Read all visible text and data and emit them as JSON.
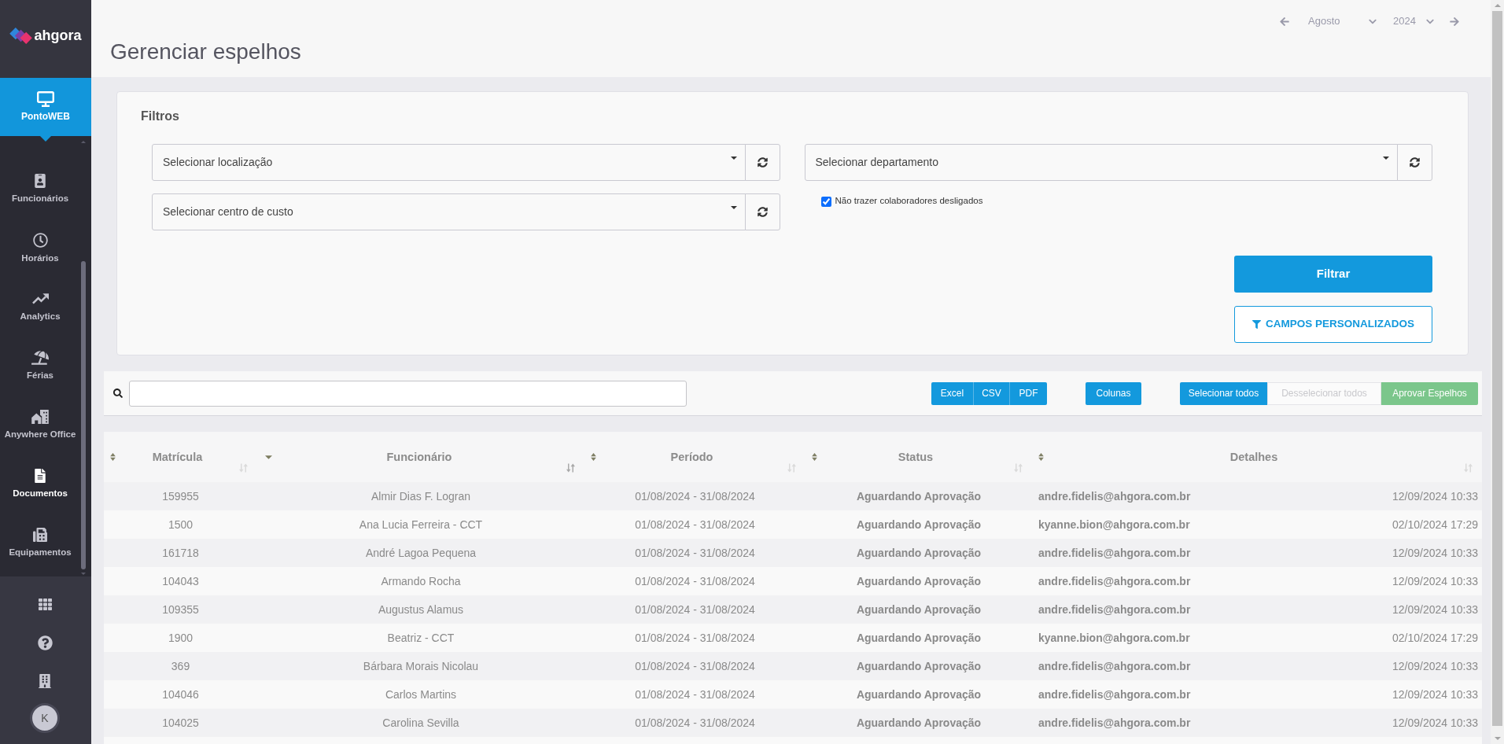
{
  "sidebar": {
    "logo": "ahgora",
    "module": {
      "label": "PontoWEB",
      "active": true
    },
    "items": [
      {
        "label": "Funcionários",
        "selected": false
      },
      {
        "label": "Horários",
        "selected": false
      },
      {
        "label": "Analytics",
        "selected": false
      },
      {
        "label": "Férias",
        "selected": false
      },
      {
        "label": "Anywhere Office",
        "selected": false
      },
      {
        "label": "Documentos",
        "selected": true
      },
      {
        "label": "Equipamentos",
        "selected": false
      }
    ],
    "user": {
      "initial": "K"
    }
  },
  "header": {
    "title": "Gerenciar espelhos",
    "month": "Agosto",
    "year": "2024"
  },
  "filters": {
    "title": "Filtros",
    "selects": [
      {
        "placeholder": "Selecionar localização"
      },
      {
        "placeholder": "Selecionar centro de custo"
      },
      {
        "placeholder": "Selecionar departamento"
      }
    ],
    "checkbox": {
      "label": "Não trazer colaboradores desligados",
      "checked": true
    },
    "submit_button": "Filtrar",
    "custom_fields_button": "CAMPOS PERSONALIZADOS"
  },
  "toolbar": {
    "export_buttons": [
      "Excel",
      "CSV",
      "PDF"
    ],
    "columns_button": "Colunas",
    "selection_buttons": [
      {
        "label": "Selecionar todos",
        "disabled": false
      },
      {
        "label": "Desselecionar todos",
        "disabled": true
      }
    ],
    "approve_button": "Aprovar Espelhos"
  },
  "table": {
    "columns": [
      {
        "label": "Matrícula",
        "sorted": false
      },
      {
        "label": "Funcionário",
        "sorted": true
      },
      {
        "label": "Período",
        "sorted": false
      },
      {
        "label": "Status",
        "sorted": false
      },
      {
        "label": "Detalhes",
        "sorted": false
      }
    ],
    "rows": [
      {
        "matricula": "159955",
        "funcionario": "Almir Dias F. Logran",
        "periodo": "01/08/2024 - 31/08/2024",
        "status": "Aguardando Aprovação",
        "email": "andre.fidelis@ahgora.com.br",
        "date": "12/09/2024 10:33"
      },
      {
        "matricula": "1500",
        "funcionario": "Ana Lucia Ferreira - CCT",
        "periodo": "01/08/2024 - 31/08/2024",
        "status": "Aguardando Aprovação",
        "email": "kyanne.bion@ahgora.com.br",
        "date": "02/10/2024 17:29"
      },
      {
        "matricula": "161718",
        "funcionario": "André Lagoa Pequena",
        "periodo": "01/08/2024 - 31/08/2024",
        "status": "Aguardando Aprovação",
        "email": "andre.fidelis@ahgora.com.br",
        "date": "12/09/2024 10:33"
      },
      {
        "matricula": "104043",
        "funcionario": "Armando Rocha",
        "periodo": "01/08/2024 - 31/08/2024",
        "status": "Aguardando Aprovação",
        "email": "andre.fidelis@ahgora.com.br",
        "date": "12/09/2024 10:33"
      },
      {
        "matricula": "109355",
        "funcionario": "Augustus Alamus",
        "periodo": "01/08/2024 - 31/08/2024",
        "status": "Aguardando Aprovação",
        "email": "andre.fidelis@ahgora.com.br",
        "date": "12/09/2024 10:33"
      },
      {
        "matricula": "1900",
        "funcionario": "Beatriz - CCT",
        "periodo": "01/08/2024 - 31/08/2024",
        "status": "Aguardando Aprovação",
        "email": "kyanne.bion@ahgora.com.br",
        "date": "02/10/2024 17:29"
      },
      {
        "matricula": "369",
        "funcionario": "Bárbara Morais Nicolau",
        "periodo": "01/08/2024 - 31/08/2024",
        "status": "Aguardando Aprovação",
        "email": "andre.fidelis@ahgora.com.br",
        "date": "12/09/2024 10:33"
      },
      {
        "matricula": "104046",
        "funcionario": "Carlos Martins",
        "periodo": "01/08/2024 - 31/08/2024",
        "status": "Aguardando Aprovação",
        "email": "andre.fidelis@ahgora.com.br",
        "date": "12/09/2024 10:33"
      },
      {
        "matricula": "104025",
        "funcionario": "Carolina Sevilla",
        "periodo": "01/08/2024 - 31/08/2024",
        "status": "Aguardando Aprovação",
        "email": "andre.fidelis@ahgora.com.br",
        "date": "12/09/2024 10:33"
      }
    ]
  }
}
